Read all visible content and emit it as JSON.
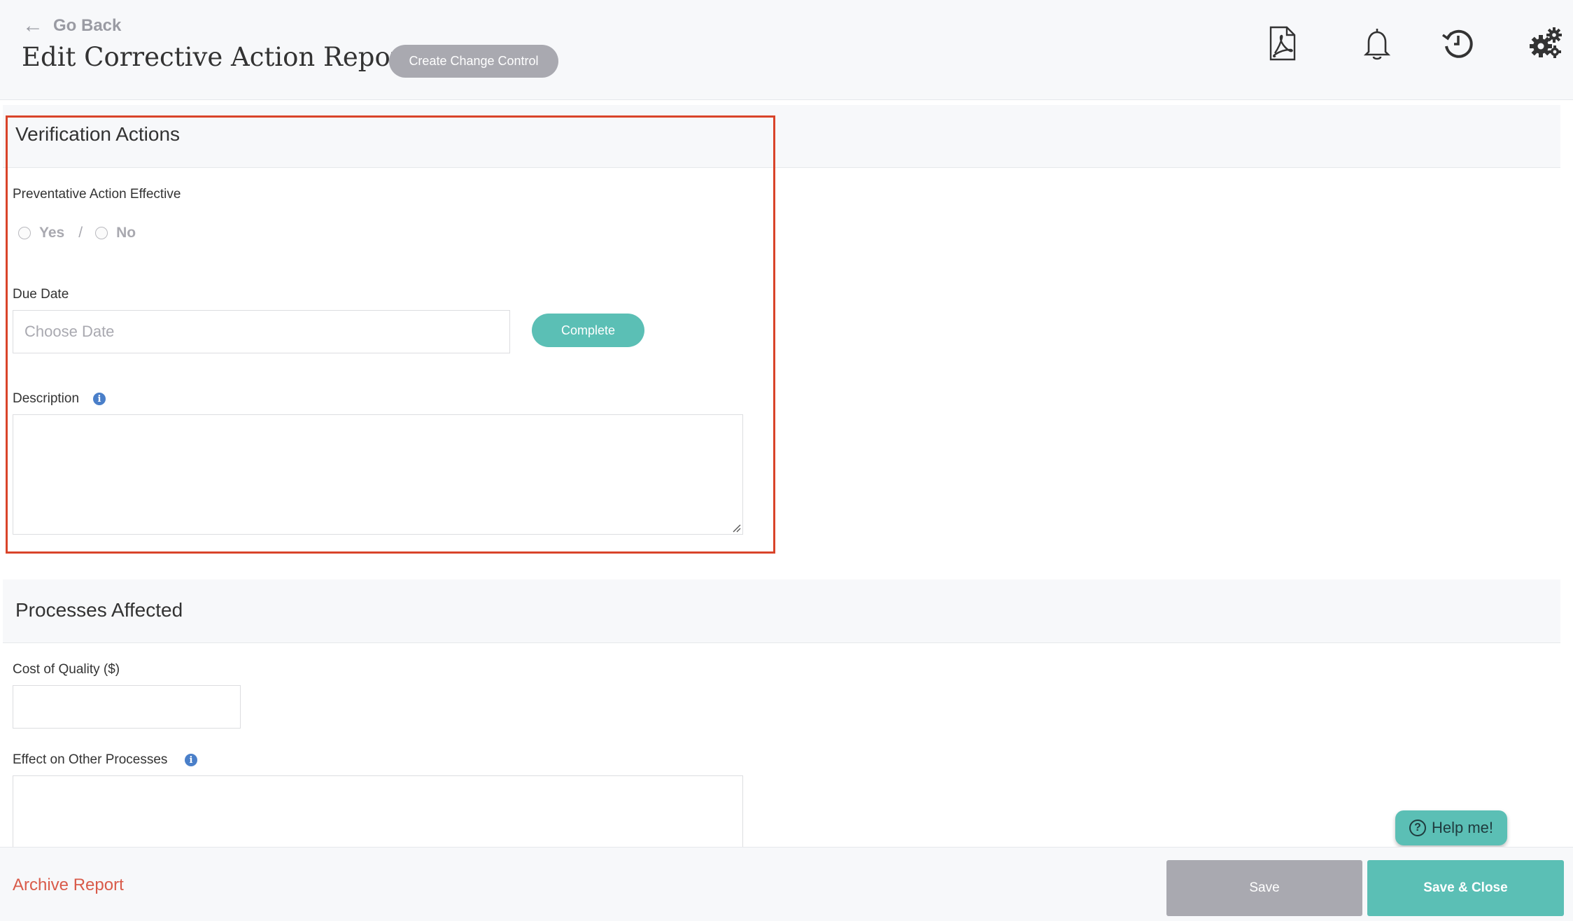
{
  "header": {
    "go_back_label": "Go Back",
    "title": "Edit Corrective Action Report",
    "create_change_control_label": "Create Change Control",
    "icons": [
      "pdf-icon",
      "bell-icon",
      "history-icon",
      "gears-icon"
    ]
  },
  "verification": {
    "title": "Verification Actions",
    "preventative_label": "Preventative Action Effective",
    "yes_label": "Yes",
    "separator": "/",
    "no_label": "No",
    "due_date_label": "Due Date",
    "due_date_placeholder": "Choose Date",
    "complete_label": "Complete",
    "description_label": "Description"
  },
  "processes": {
    "title": "Processes Affected",
    "cost_label": "Cost of Quality ($)",
    "effect_label": "Effect on Other Processes"
  },
  "help": {
    "label": "Help me!"
  },
  "footer": {
    "archive_label": "Archive Report",
    "save_label": "Save",
    "save_close_label": "Save & Close"
  },
  "colors": {
    "accent": "#5bbfb5",
    "muted_button": "#a9a9b0",
    "highlight_border": "#d9442a",
    "archive_text": "#d95b4a",
    "info": "#4a7fc9"
  }
}
